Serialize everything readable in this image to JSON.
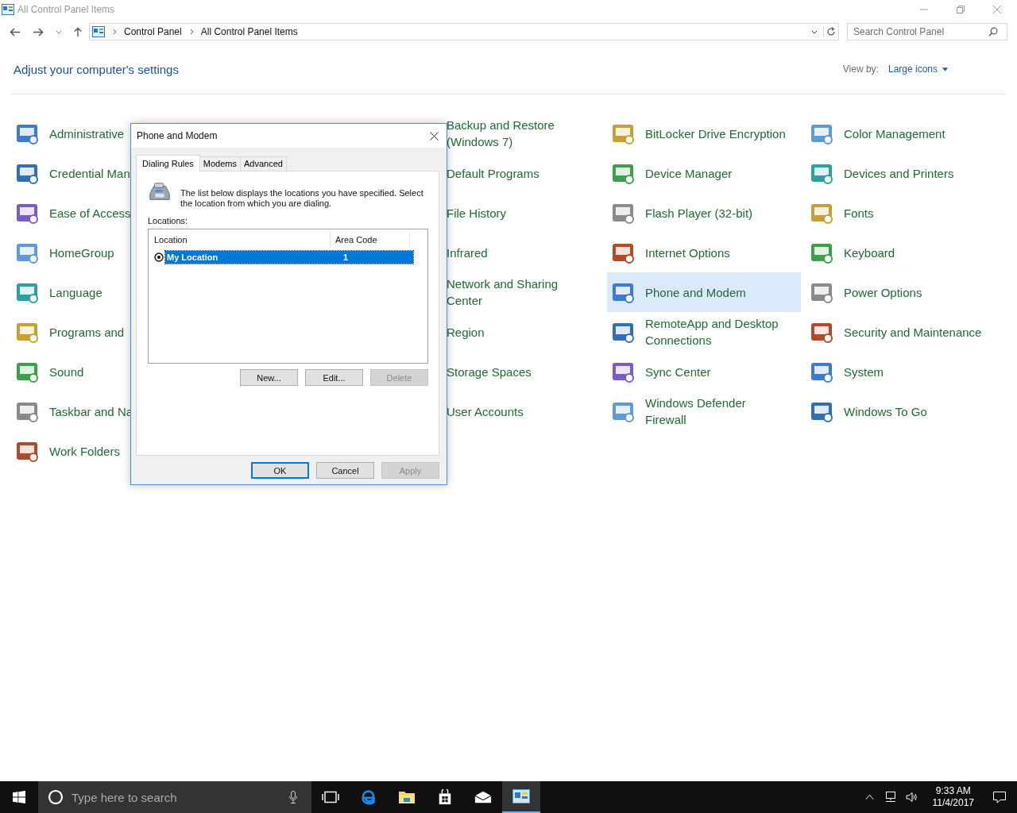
{
  "window": {
    "title": "All Control Panel Items"
  },
  "address_bar": {
    "breadcrumbs": [
      "Control Panel",
      "All Control Panel Items"
    ]
  },
  "search": {
    "placeholder": "Search Control Panel"
  },
  "header": {
    "title": "Adjust your computer's settings",
    "view_by_label": "View by:",
    "view_by_value": "Large icons"
  },
  "columns": [
    {
      "items": [
        {
          "label": "Administrative",
          "selected": false
        },
        {
          "label": "Credential Man",
          "selected": false
        },
        {
          "label": "Ease of Access",
          "selected": false
        },
        {
          "label": "HomeGroup",
          "selected": false
        },
        {
          "label": "Language",
          "selected": false
        },
        {
          "label": "Programs and",
          "selected": false
        },
        {
          "label": "Sound",
          "selected": false
        },
        {
          "label": "Taskbar and Na",
          "selected": false
        },
        {
          "label": "Work Folders",
          "selected": false
        }
      ]
    },
    {
      "items": [
        {
          "label": "Backup and Restore (Windows 7)",
          "selected": false
        },
        {
          "label": "Default Programs",
          "selected": false
        },
        {
          "label": "File History",
          "selected": false
        },
        {
          "label": "Infrared",
          "selected": false
        },
        {
          "label": "Network and Sharing Center",
          "selected": false
        },
        {
          "label": "Region",
          "selected": false
        },
        {
          "label": "Storage Spaces",
          "selected": false
        },
        {
          "label": "User Accounts",
          "selected": false
        }
      ]
    },
    {
      "items": [
        {
          "label": "BitLocker Drive Encryption",
          "selected": false
        },
        {
          "label": "Device Manager",
          "selected": false
        },
        {
          "label": "Flash Player (32-bit)",
          "selected": false
        },
        {
          "label": "Internet Options",
          "selected": false
        },
        {
          "label": "Phone and Modem",
          "selected": true
        },
        {
          "label": "RemoteApp and Desktop Connections",
          "selected": false
        },
        {
          "label": "Sync Center",
          "selected": false
        },
        {
          "label": "Windows Defender Firewall",
          "selected": false
        }
      ]
    },
    {
      "items": [
        {
          "label": "Color Management",
          "selected": false
        },
        {
          "label": "Devices and Printers",
          "selected": false
        },
        {
          "label": "Fonts",
          "selected": false
        },
        {
          "label": "Keyboard",
          "selected": false
        },
        {
          "label": "Power Options",
          "selected": false
        },
        {
          "label": "Security and Maintenance",
          "selected": false
        },
        {
          "label": "System",
          "selected": false
        },
        {
          "label": "Windows To Go",
          "selected": false
        }
      ]
    }
  ],
  "dialog": {
    "title": "Phone and Modem",
    "tabs": [
      {
        "label": "Dialing Rules",
        "selected": true
      },
      {
        "label": "Modems",
        "selected": false
      },
      {
        "label": "Advanced",
        "selected": false
      }
    ],
    "description": "The list below displays the locations you have specified. Select the location from which you are dialing.",
    "locations_label": "Locations:",
    "list": {
      "columns": [
        "Location",
        "Area Code"
      ],
      "rows": [
        {
          "location": "My Location",
          "area_code": "1",
          "selected": true
        }
      ]
    },
    "list_buttons": [
      {
        "label": "New...",
        "disabled": false
      },
      {
        "label": "Edit...",
        "disabled": false
      },
      {
        "label": "Delete",
        "disabled": true
      }
    ],
    "footer_buttons": [
      {
        "label": "OK",
        "disabled": false,
        "default": true
      },
      {
        "label": "Cancel",
        "disabled": false,
        "default": false
      },
      {
        "label": "Apply",
        "disabled": true,
        "default": false
      }
    ]
  },
  "taskbar": {
    "search_placeholder": "Type here to search",
    "apps": [
      {
        "kind": "taskview",
        "selected": false
      },
      {
        "kind": "browser",
        "selected": false
      },
      {
        "kind": "folder",
        "selected": false
      },
      {
        "kind": "store",
        "selected": false
      },
      {
        "kind": "mail",
        "selected": false
      },
      {
        "kind": "panel",
        "selected": true
      }
    ],
    "time": "9:33 AM",
    "date": "11/4/2017"
  }
}
